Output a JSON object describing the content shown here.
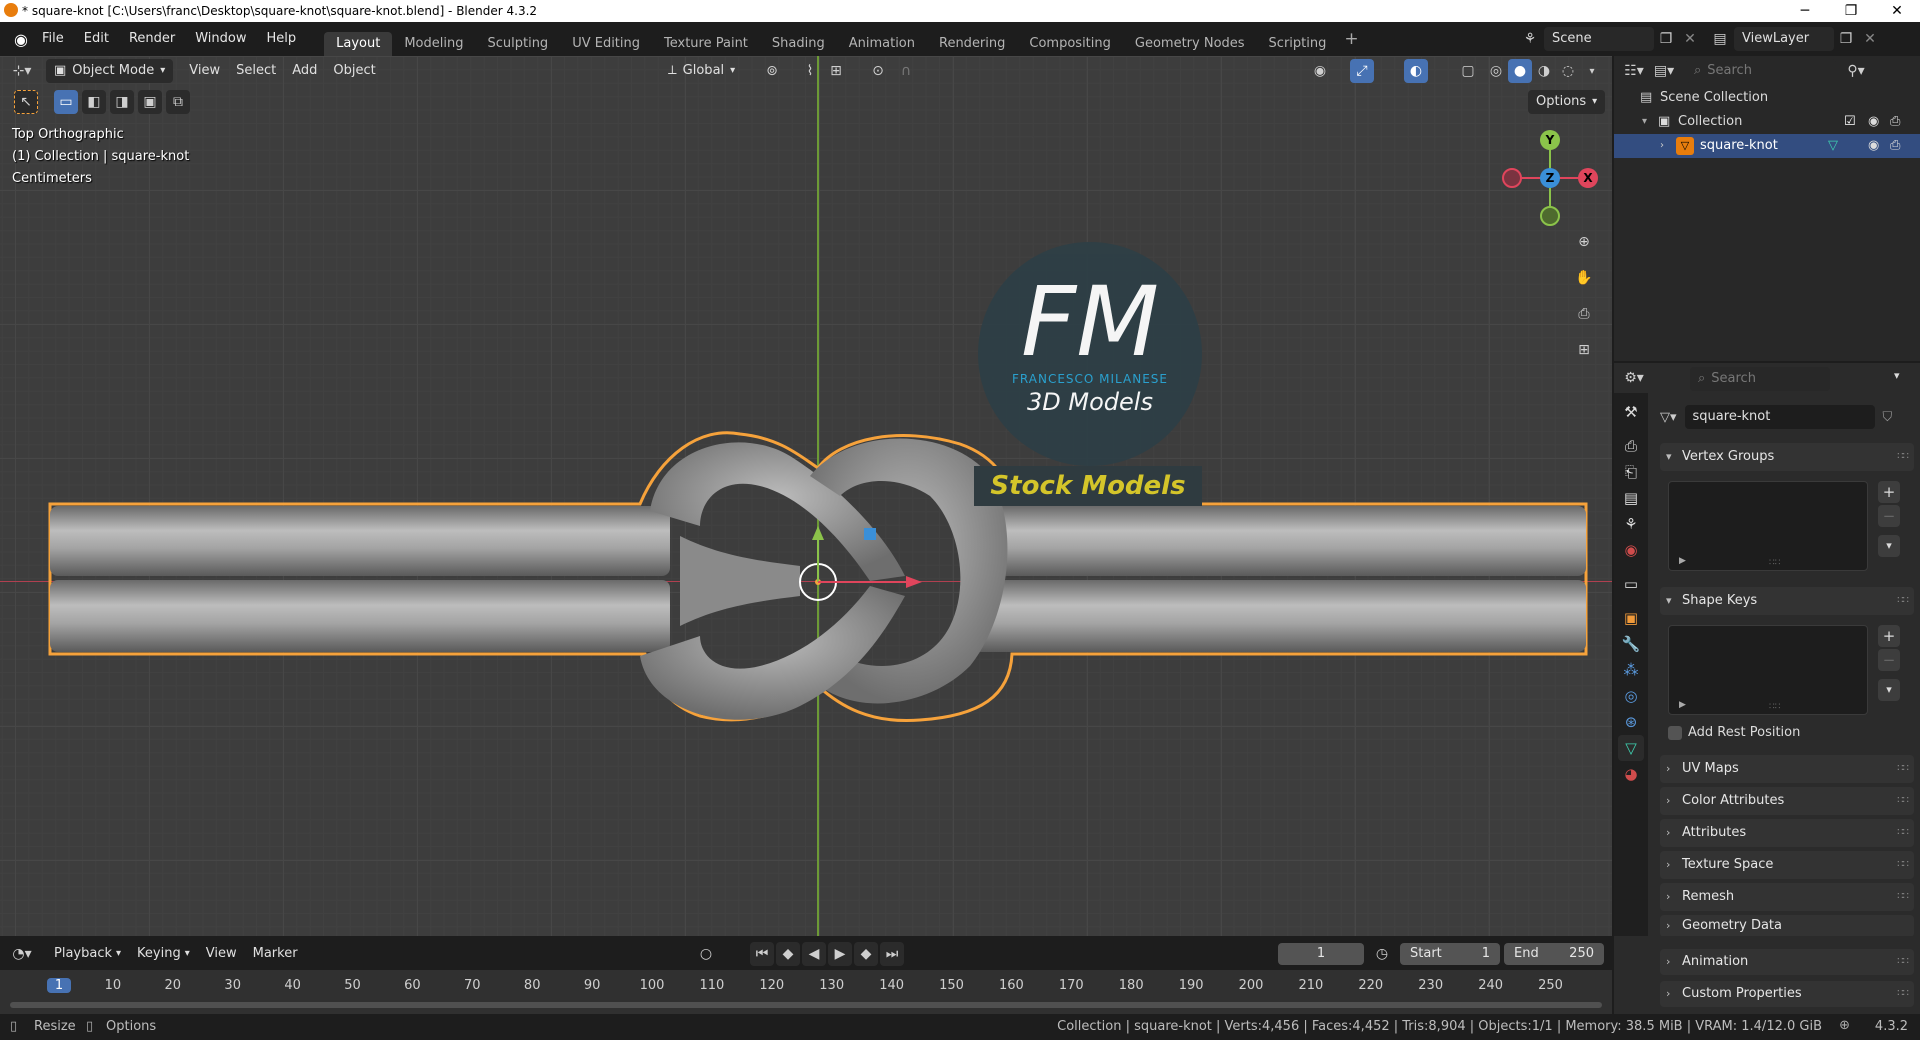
{
  "window": {
    "title": "* square-knot [C:\\Users\\franc\\Desktop\\square-knot\\square-knot.blend] - Blender 4.3.2",
    "min_icon": "minimize-icon",
    "max_icon": "maximize-icon",
    "close_icon": "close-icon"
  },
  "menu": {
    "file": "File",
    "edit": "Edit",
    "render": "Render",
    "window": "Window",
    "help": "Help"
  },
  "workspaces": [
    "Layout",
    "Modeling",
    "Sculpting",
    "UV Editing",
    "Texture Paint",
    "Shading",
    "Animation",
    "Rendering",
    "Compositing",
    "Geometry Nodes",
    "Scripting"
  ],
  "active_workspace": "Layout",
  "scene": {
    "name": "Scene",
    "view_layer": "ViewLayer"
  },
  "viewport_header": {
    "mode": "Object Mode",
    "view": "View",
    "select": "Select",
    "add": "Add",
    "object": "Object",
    "orientation": "Global",
    "options": "Options"
  },
  "viewport_overlay": {
    "view_name": "Top Orthographic",
    "collection_info": "(1) Collection | square-knot",
    "units": "Centimeters"
  },
  "gizmo": {
    "y": "Y",
    "z": "Z",
    "x": "X"
  },
  "watermark": {
    "initials": "FM",
    "author": "FRANCESCO MILANESE",
    "subtitle": "3D Models",
    "banner": "Stock Models"
  },
  "outliner": {
    "search_placeholder": "Search",
    "scene_collection": "Scene Collection",
    "collection": "Collection",
    "object": "square-knot"
  },
  "properties": {
    "search_placeholder": "Search",
    "object_name": "square-knot",
    "panels": {
      "vertex_groups": "Vertex Groups",
      "shape_keys": "Shape Keys",
      "add_rest_position": "Add Rest Position",
      "uv_maps": "UV Maps",
      "color_attributes": "Color Attributes",
      "attributes": "Attributes",
      "texture_space": "Texture Space",
      "remesh": "Remesh",
      "geometry_data": "Geometry Data",
      "animation": "Animation",
      "custom_properties": "Custom Properties"
    }
  },
  "timeline": {
    "playback": "Playback",
    "keying": "Keying",
    "view": "View",
    "marker": "Marker",
    "current_frame": "1",
    "start_label": "Start",
    "start_value": "1",
    "end_label": "End",
    "end_value": "250",
    "ruler": [
      "1",
      "10",
      "20",
      "30",
      "40",
      "50",
      "60",
      "70",
      "80",
      "90",
      "100",
      "110",
      "120",
      "130",
      "140",
      "150",
      "160",
      "170",
      "180",
      "190",
      "200",
      "210",
      "220",
      "230",
      "240",
      "250"
    ]
  },
  "statusbar": {
    "resize": "Resize",
    "options": "Options",
    "stats": "Collection | square-knot | Verts:4,456 | Faces:4,452 | Tris:8,904 | Objects:1/1 | Memory: 38.5 MiB | VRAM: 1.4/12.0 GiB",
    "version": "4.3.2"
  },
  "colors": {
    "accent": "#4772b3",
    "selection": "#f6a23b",
    "axis_x": "#e0455c",
    "axis_y": "#8bc34a",
    "axis_z": "#3a8fd8"
  }
}
